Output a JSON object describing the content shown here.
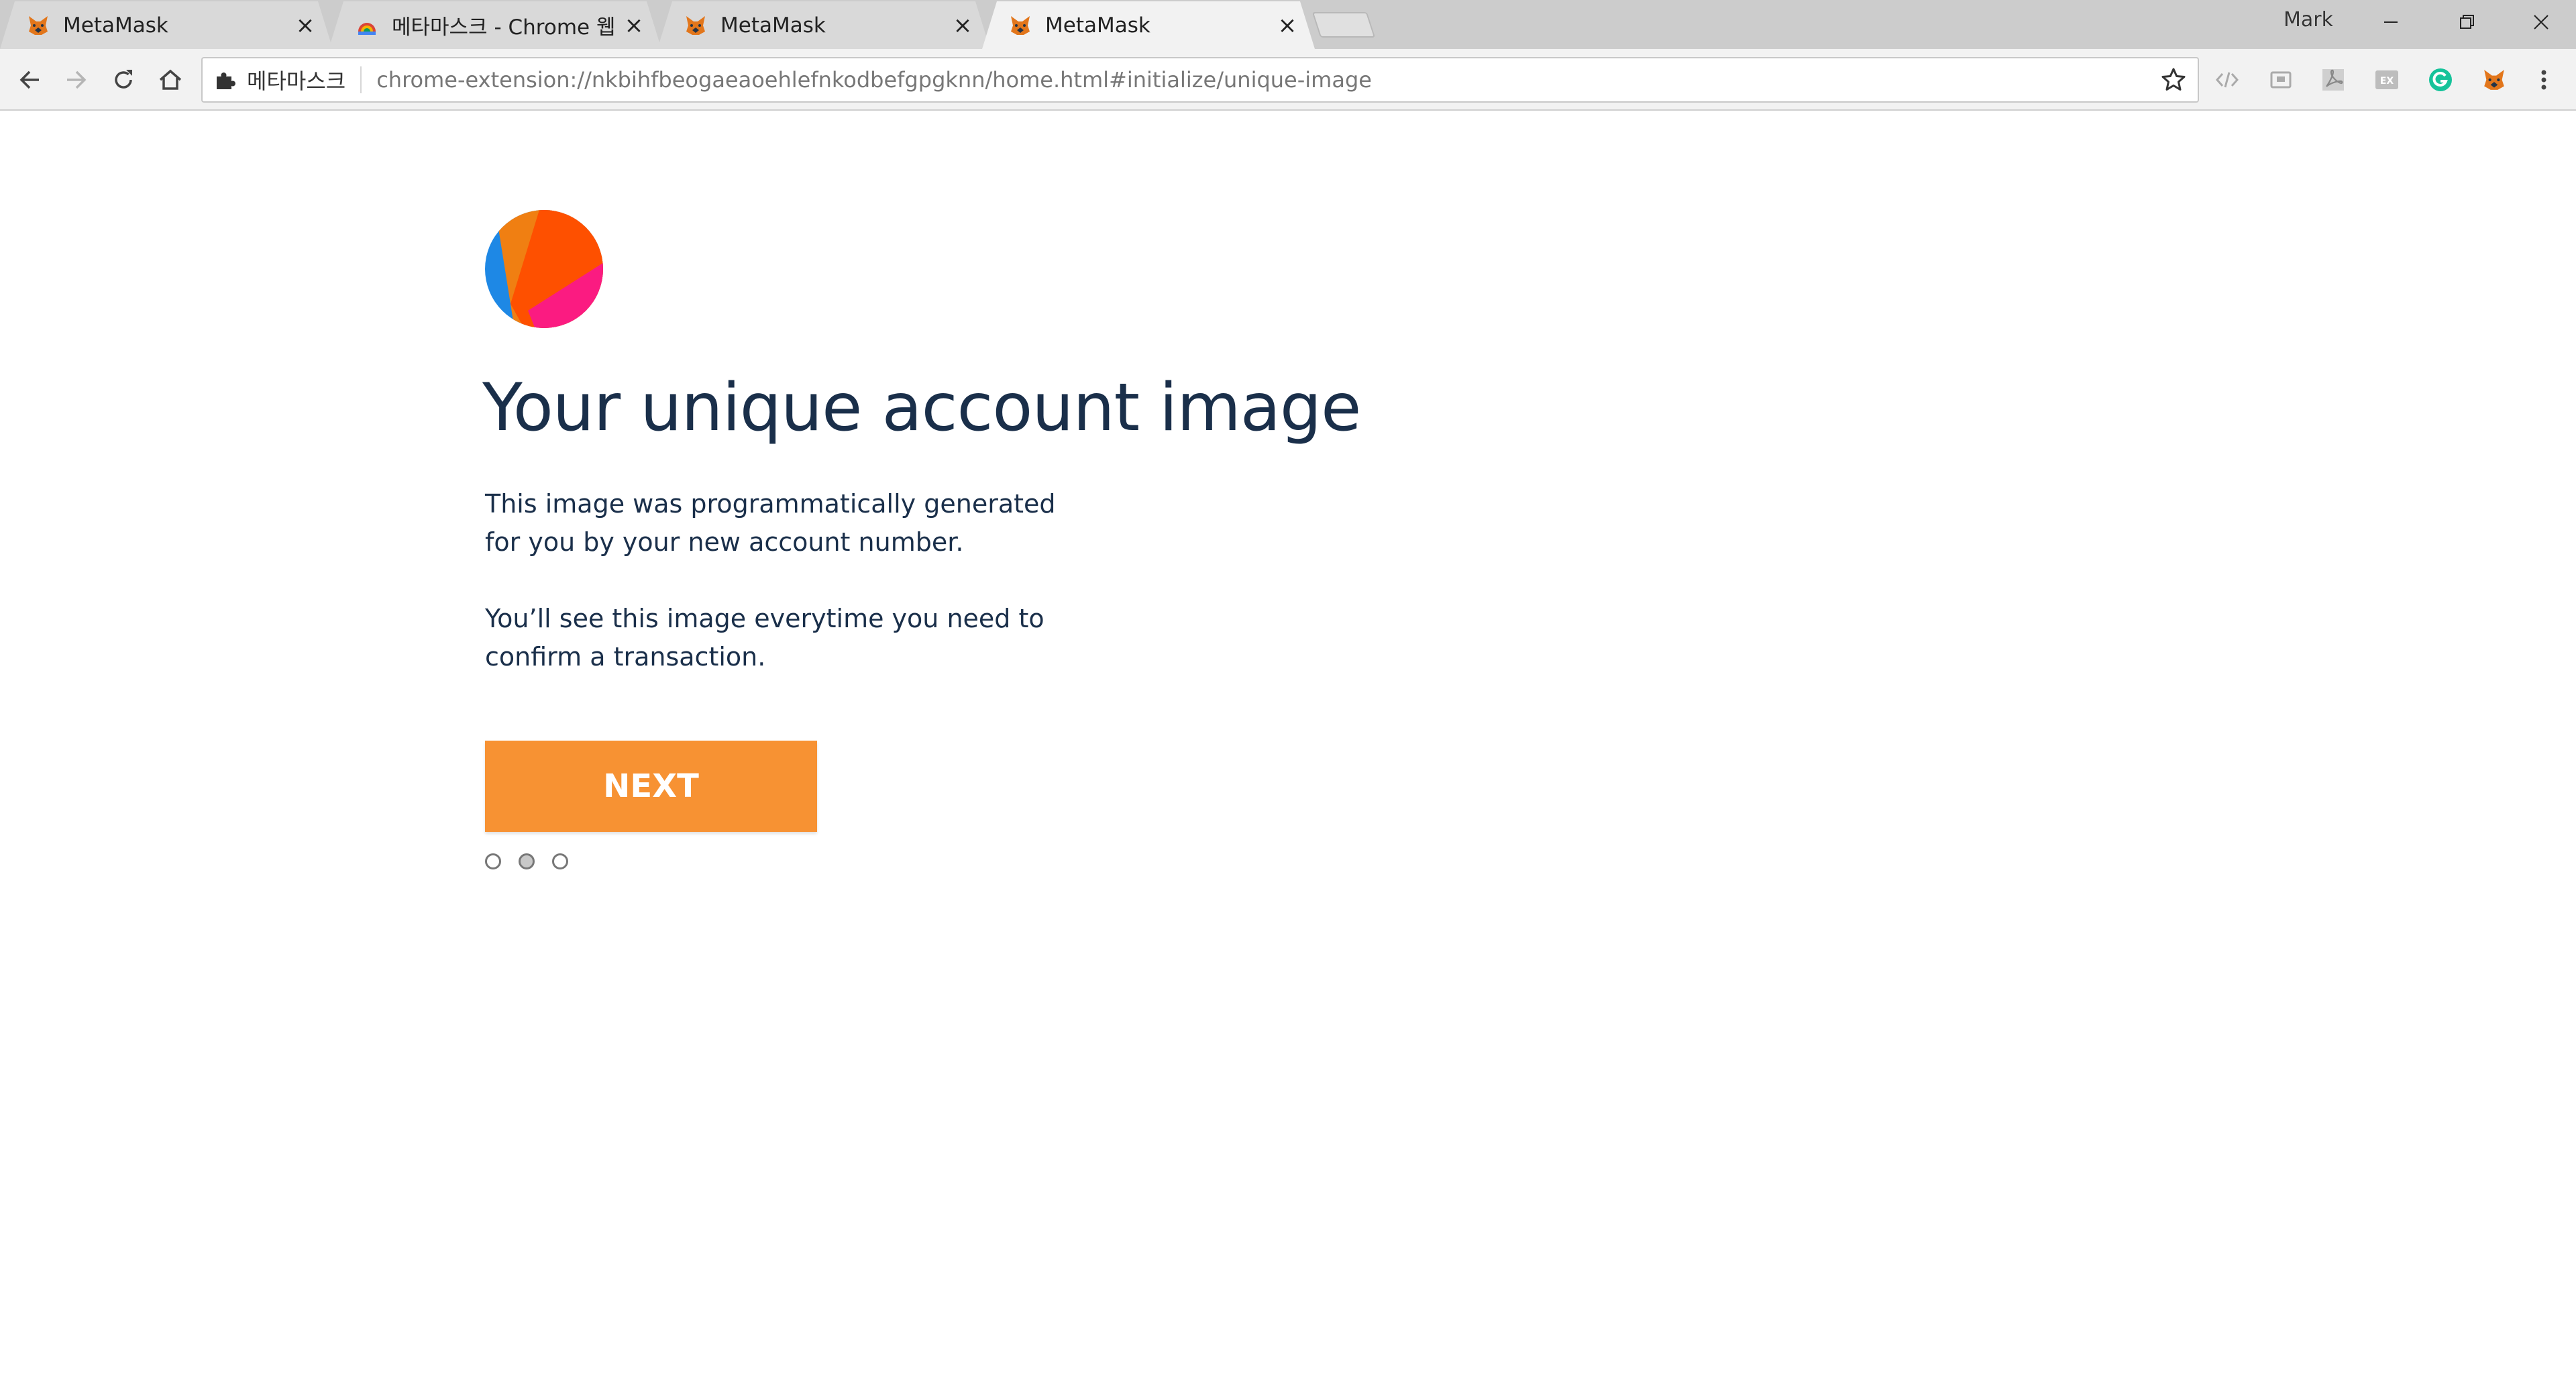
{
  "browser": {
    "tabs": [
      {
        "title": "MetaMask",
        "icon": "metamask-fox-icon",
        "active": false
      },
      {
        "title": "메타마스크 - Chrome 웹",
        "icon": "chrome-web-store-icon",
        "active": false
      },
      {
        "title": "MetaMask",
        "icon": "metamask-fox-icon",
        "active": false
      },
      {
        "title": "MetaMask",
        "icon": "metamask-fox-icon",
        "active": true
      }
    ],
    "close_glyph": "×",
    "profile_name": "Mark",
    "omnibox": {
      "site_label": "메타마스크",
      "url": "chrome-extension://nkbihfbeogaeaoehlefnkodbefgpgknn/home.html#initialize/unique-image"
    }
  },
  "page": {
    "title": "Your unique account image",
    "paragraph_1_line_1": "This image was programmatically generated",
    "paragraph_1_line_2": "for you by your new account number.",
    "paragraph_2_line_1": "You’ll see this image everytime you need to",
    "paragraph_2_line_2": "confirm a transaction.",
    "next_label": "NEXT",
    "steps": {
      "total": 3,
      "current": 2
    }
  },
  "colors": {
    "title": "#1a2f4a",
    "button": "#f79233",
    "identicon": [
      "#1e88e5",
      "#f07f12",
      "#fe5000",
      "#fb1b81"
    ]
  }
}
